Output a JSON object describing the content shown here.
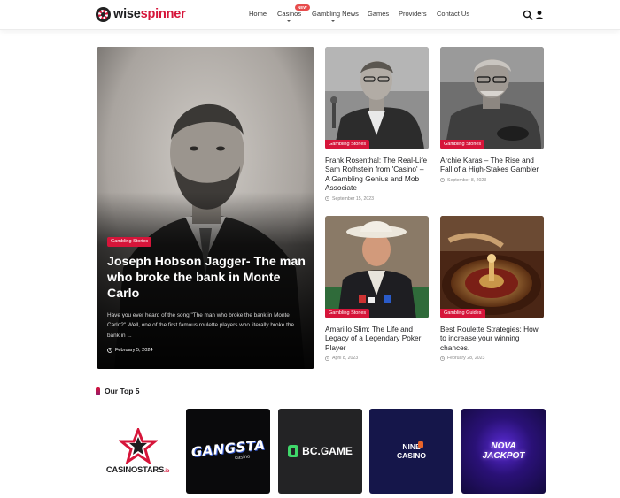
{
  "brand": {
    "name_part1": "wise",
    "name_part2": "spinner"
  },
  "nav": {
    "home": "Home",
    "casinos": "Casinos",
    "casinos_badge": "NEW",
    "gambling_news": "Gambling News",
    "games": "Games",
    "providers": "Providers",
    "contact": "Contact Us"
  },
  "featured": {
    "tag": "Gambling Stories",
    "title": "Joseph Hobson Jagger- The man who broke the bank in Monte Carlo",
    "excerpt": "Have you ever heard of the song \"The man who broke the bank in Monte Carlo?\" Well, one of the first famous roulette players who literally broke the bank in ...",
    "date": "February 5, 2024"
  },
  "cards": [
    {
      "tag": "Gambling Stories",
      "title": "Frank Rosenthal: The Real-Life Sam Rothstein from 'Casino' – A Gambling Genius and Mob Associate",
      "date": "September 15, 2023"
    },
    {
      "tag": "Gambling Stories",
      "title": "Archie Karas – The Rise and Fall of a High-Stakes Gambler",
      "date": "September 8, 2023"
    },
    {
      "tag": "Gambling Stories",
      "title": "Amarillo Slim: The Life and Legacy of a Legendary Poker Player",
      "date": "April 8, 2023"
    },
    {
      "tag": "Gambling Guides",
      "title": "Best Roulette Strategies: How to increase your winning chances.",
      "date": "February 28, 2023"
    }
  ],
  "top5": {
    "title": "Our Top 5",
    "casinos": [
      {
        "line1": "CASINOSTARS",
        "line2": ".io"
      },
      {
        "line1": "GANGSTA",
        "line2": "casino"
      },
      {
        "line1": "BC.GAME",
        "line2": ""
      },
      {
        "line1": "NINE",
        "line2": "CASINO"
      },
      {
        "line1": "NOVA",
        "line2": "JACKPOT"
      }
    ]
  },
  "colors": {
    "accent": "#d6153a",
    "text": "#1d1d1f"
  },
  "icons": {
    "search": "search-icon",
    "account": "user-icon",
    "clock": "clock-icon"
  }
}
